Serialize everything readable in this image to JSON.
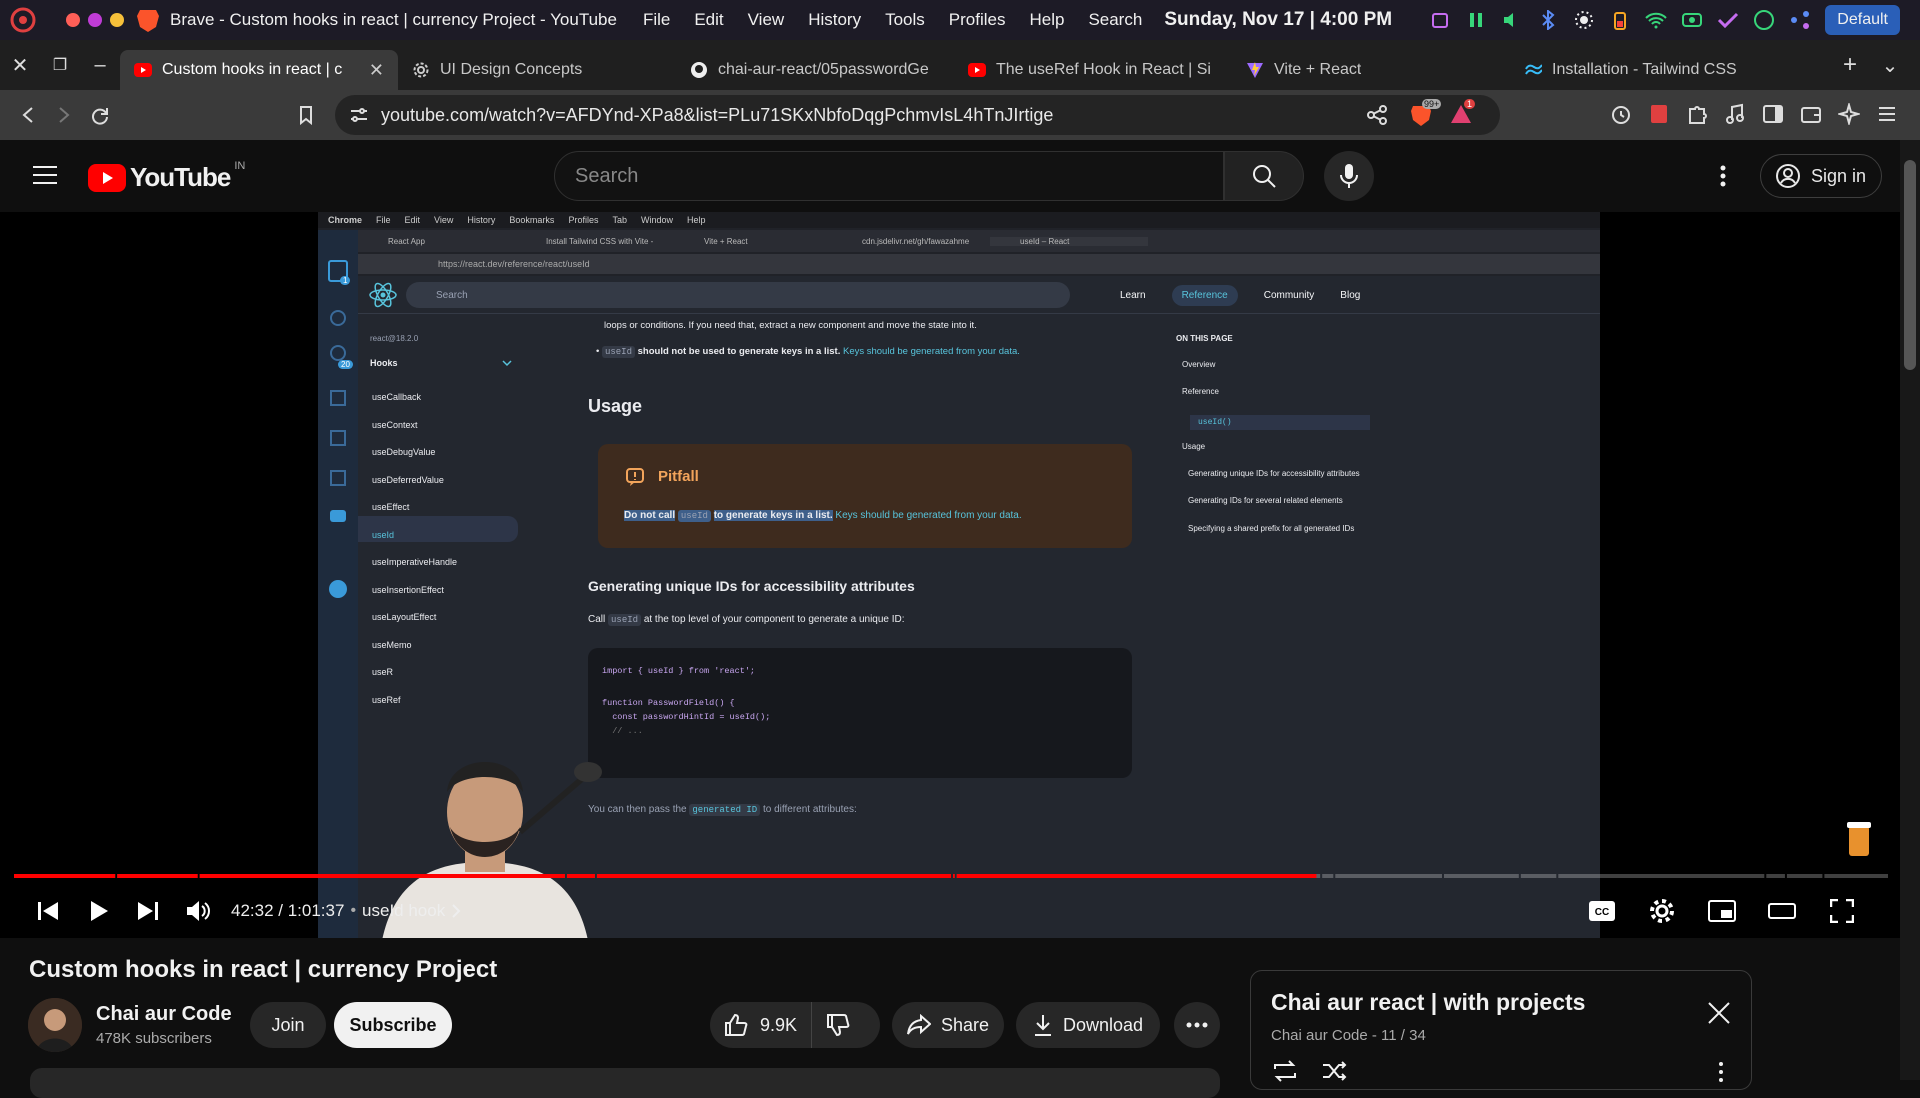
{
  "os_menubar": {
    "app_name": "Brave - Custom hooks in react | currency Project - YouTube",
    "menus": [
      "File",
      "Edit",
      "View",
      "History",
      "Tools",
      "Profiles",
      "Help",
      "Search"
    ],
    "datetime": "Sunday, Nov 17 | 4:00 PM",
    "profile_chip": "Default"
  },
  "browser_tabs": [
    {
      "title": "Custom hooks in react | c",
      "favicon": "youtube-icon",
      "active": true
    },
    {
      "title": "UI Design Concepts",
      "favicon": "gear-icon",
      "active": false
    },
    {
      "title": "chai-aur-react/05passwordGe",
      "favicon": "github-icon",
      "active": false
    },
    {
      "title": "The useRef Hook in React | Si",
      "favicon": "youtube-icon",
      "active": false
    },
    {
      "title": "Vite + React",
      "favicon": "vite-icon",
      "active": false
    },
    {
      "title": "Installation - Tailwind CSS",
      "favicon": "tailwind-icon",
      "active": false
    }
  ],
  "address_bar": {
    "url": "youtube.com/watch?v=AFDYnd-XPa8&list=PLu71SKxNbfoDqgPchmvIsL4hTnJIrtige",
    "shield_badge": "99+",
    "alert_badge": "1"
  },
  "youtube_header": {
    "logo_text": "YouTube",
    "region": "IN",
    "search_placeholder": "Search",
    "sign_in_label": "Sign in"
  },
  "video_frame": {
    "inner_menubar": [
      "Chrome",
      "File",
      "Edit",
      "View",
      "History",
      "Bookmarks",
      "Profiles",
      "Tab",
      "Window",
      "Help"
    ],
    "inner_tabs": [
      "React App",
      "Install Tailwind CSS with Vite -",
      "Vite + React",
      "cdn.jsdelivr.net/gh/fawazahme",
      "useId – React"
    ],
    "inner_url": "https://react.dev/reference/react/useId",
    "react_search": "Search",
    "react_nav": [
      "Learn",
      "Reference",
      "Community",
      "Blog"
    ],
    "version": "react@18.2.0",
    "hooks_heading": "Hooks",
    "hooks": [
      "useCallback",
      "useContext",
      "useDebugValue",
      "useDeferredValue",
      "useEffect",
      "useId",
      "useImperativeHandle",
      "useInsertionEffect",
      "useLayoutEffect",
      "useMemo",
      "useR",
      "useRef"
    ],
    "intro_line": "loops or conditions. If you need that, extract a new component and move the state into it.",
    "bullet_code": "useId",
    "bullet_text": "should not be used to generate keys in a list.",
    "bullet_link": "Keys should be generated from your data.",
    "usage_heading": "Usage",
    "pitfall_title": "Pitfall",
    "pitfall_pre": "Do not call",
    "pitfall_code": "useId",
    "pitfall_post": "to generate keys in a list.",
    "pitfall_link": "Keys should be generated from your data.",
    "section_heading": "Generating unique IDs for accessibility attributes",
    "call_pre": "Call",
    "call_code": "useId",
    "call_post": "at the top level of your component to generate a unique ID:",
    "code_lines": [
      "import { useId } from 'react';",
      "function PasswordField() {",
      "  const passwordHintId = useId();",
      "  // ..."
    ],
    "then_pre": "You can then pass the",
    "then_code": "generated ID",
    "then_post": "to different attributes:",
    "toc_heading": "ON THIS PAGE",
    "toc": [
      "Overview",
      "Reference",
      "useId()",
      "Usage",
      "Generating unique IDs for accessibility attributes",
      "Generating IDs for several related elements",
      "Specifying a shared prefix for all generated IDs"
    ],
    "vscode_badges": [
      "1",
      "20"
    ]
  },
  "player": {
    "progress": 0.695,
    "time": "42:32 / 1:01:37",
    "chapter": "useId hook"
  },
  "video": {
    "title": "Custom hooks in react | currency Project",
    "channel": "Chai aur Code",
    "subscribers": "478K subscribers",
    "join": "Join",
    "subscribe": "Subscribe",
    "likes": "9.9K",
    "share": "Share",
    "download": "Download"
  },
  "playlist": {
    "title": "Chai aur react | with projects",
    "meta": "Chai aur Code - 11 / 34"
  },
  "colors": {
    "youtube_red": "#ff0000",
    "react_blue": "#58c4dc",
    "pitfall_orange": "#f2a45b"
  }
}
